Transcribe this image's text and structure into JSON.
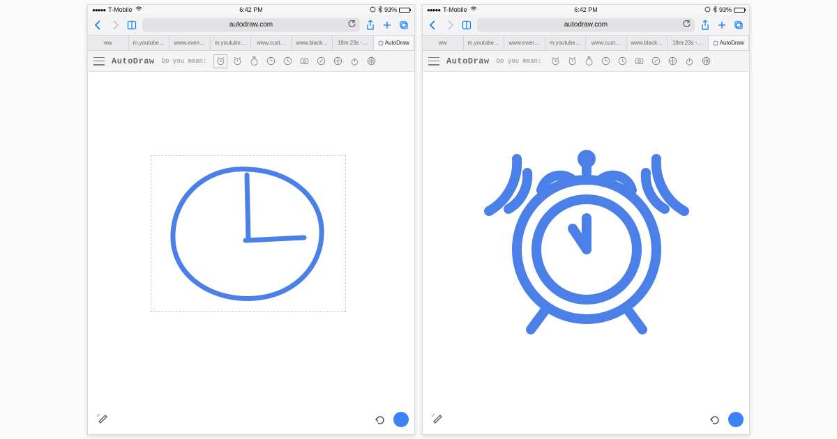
{
  "status_bar": {
    "carrier_dots": "●●●●●",
    "carrier": "T-Mobile",
    "time": "6:42 PM",
    "battery_pct": "93%"
  },
  "browser": {
    "url": "autodraw.com",
    "tabs": [
      {
        "label": "ww"
      },
      {
        "label": "m.youtube…"
      },
      {
        "label": "www.even…"
      },
      {
        "label": "m.youtube…"
      },
      {
        "label": "www.cust…"
      },
      {
        "label": "www.black…"
      },
      {
        "label": "18m:23s -…"
      },
      {
        "label": "AutoDraw",
        "active": true
      }
    ]
  },
  "app": {
    "title": "AutoDraw",
    "prompt": "Do you mean:",
    "suggestions": [
      {
        "name": "alarm-clock",
        "selected_left": true
      },
      {
        "name": "alarm-clock-alt"
      },
      {
        "name": "stopwatch"
      },
      {
        "name": "clock"
      },
      {
        "name": "wall-clock"
      },
      {
        "name": "camera"
      },
      {
        "name": "compass"
      },
      {
        "name": "target"
      },
      {
        "name": "timer"
      },
      {
        "name": "basketball"
      }
    ]
  },
  "canvas": {
    "left": "user-sketch-clock",
    "right": "alarm-clock-result",
    "color": "#4a80e8"
  }
}
